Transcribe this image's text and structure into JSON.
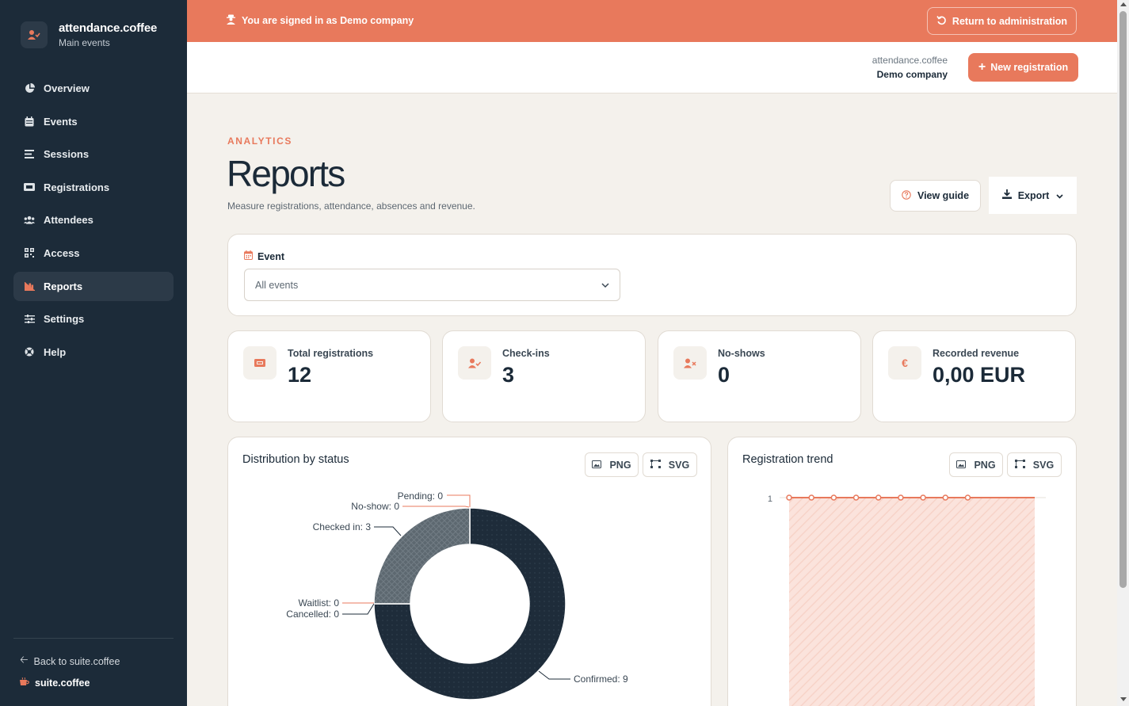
{
  "app": {
    "name": "attendance.coffee",
    "subtitle": "Main events"
  },
  "sidebar": {
    "items": [
      {
        "label": "Overview",
        "icon": "pie-chart-icon"
      },
      {
        "label": "Events",
        "icon": "calendar-icon"
      },
      {
        "label": "Sessions",
        "icon": "list-icon"
      },
      {
        "label": "Registrations",
        "icon": "ticket-icon"
      },
      {
        "label": "Attendees",
        "icon": "users-icon"
      },
      {
        "label": "Access",
        "icon": "qr-code-icon"
      },
      {
        "label": "Reports",
        "icon": "chart-icon",
        "active": true
      },
      {
        "label": "Settings",
        "icon": "sliders-icon"
      },
      {
        "label": "Help",
        "icon": "lifebuoy-icon"
      }
    ],
    "back_link": "Back to suite.coffee",
    "suite_name": "suite.coffee"
  },
  "banner": {
    "message": "You are signed in as Demo company",
    "return_label": "Return to administration"
  },
  "header": {
    "account_app": "attendance.coffee",
    "account_company": "Demo company",
    "new_registration_label": "New registration"
  },
  "page": {
    "eyebrow": "ANALYTICS",
    "title": "Reports",
    "subtitle": "Measure registrations, attendance, absences and revenue.",
    "view_guide_label": "View guide",
    "export_label": "Export"
  },
  "filter": {
    "label": "Event",
    "selected": "All events"
  },
  "stats": [
    {
      "label": "Total registrations",
      "value": "12",
      "icon": "ticket-icon"
    },
    {
      "label": "Check-ins",
      "value": "3",
      "icon": "user-check-icon"
    },
    {
      "label": "No-shows",
      "value": "0",
      "icon": "user-x-icon"
    },
    {
      "label": "Recorded revenue",
      "value": "0,00 EUR",
      "icon": "euro-icon"
    }
  ],
  "charts": {
    "png_label": "PNG",
    "svg_label": "SVG",
    "distribution_title": "Distribution by status",
    "trend_title": "Registration trend"
  },
  "colors": {
    "accent": "#e8795c",
    "sidebar": "#1c2b39",
    "navy": "#1e2c3a",
    "slate": "#5d6870"
  },
  "chart_data": [
    {
      "type": "pie",
      "title": "Distribution by status",
      "categories": [
        "Confirmed",
        "Pending",
        "No-show",
        "Checked in",
        "Waitlist",
        "Cancelled"
      ],
      "values": [
        9,
        0,
        0,
        3,
        0,
        0
      ],
      "labels": [
        "Confirmed: 9",
        "Pending: 0",
        "No-show: 0",
        "Checked in: 3",
        "Waitlist: 0",
        "Cancelled: 0"
      ],
      "donut": true
    },
    {
      "type": "area",
      "title": "Registration trend",
      "y_tick_labels": [
        "1"
      ],
      "values": [
        1,
        1,
        1,
        1,
        1,
        1,
        1,
        1,
        1,
        1,
        1,
        1
      ],
      "ylim": [
        0,
        1
      ]
    }
  ]
}
